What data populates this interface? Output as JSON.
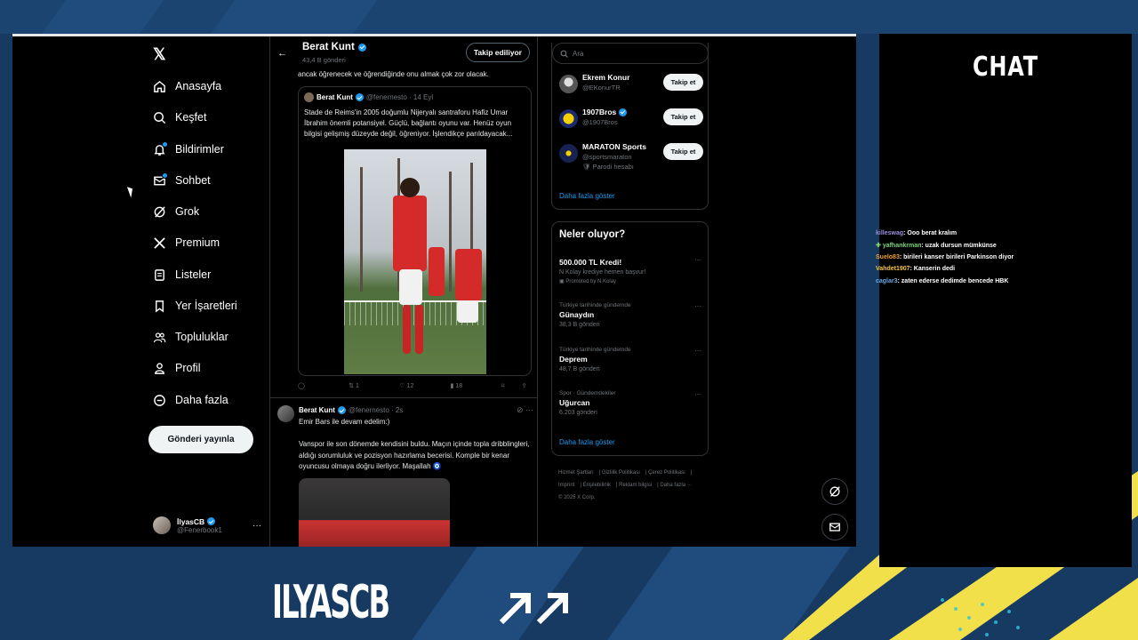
{
  "nav": {
    "items": [
      {
        "label": "Anasayfa",
        "icon": "home-icon"
      },
      {
        "label": "Keşfet",
        "icon": "search-icon"
      },
      {
        "label": "Bildirimler",
        "icon": "bell-icon"
      },
      {
        "label": "Sohbet",
        "icon": "mail-icon"
      },
      {
        "label": "Grok",
        "icon": "grok-icon"
      },
      {
        "label": "Premium",
        "icon": "x-icon"
      },
      {
        "label": "Listeler",
        "icon": "list-icon"
      },
      {
        "label": "Yer İşaretleri",
        "icon": "bookmark-icon"
      },
      {
        "label": "Topluluklar",
        "icon": "people-icon"
      },
      {
        "label": "Profil",
        "icon": "person-icon"
      },
      {
        "label": "Daha fazla",
        "icon": "more-circle-icon"
      }
    ],
    "post_button": "Gönderi yayınla",
    "account": {
      "name": "İlyasCB",
      "handle": "@Fenerbook1"
    }
  },
  "thread": {
    "header": {
      "name": "Berat Kunt",
      "posts": "43,4 B gönderi",
      "follow_label": "Takip ediliyor"
    },
    "snippet": "ancak öğrenecek ve öğrendiğinde onu almak çok zor olacak.",
    "quote": {
      "name": "Berat Kunt",
      "handle": "@fenernesto · 14 Eyl",
      "text": "Stade de Reims'in 2005 doğumlu Nijeryalı santraforu Hafiz Umar İbrahim önemli potansiyel. Güçlü, bağlantı oyunu var. Henüz oyun bilgisi gelişmiş düzeyde değil, öğreniyor. İşlendikçe parıldayacak..."
    },
    "actions": {
      "retweets": "1",
      "likes": "12",
      "views": "18"
    },
    "post2": {
      "name": "Berat Kunt",
      "handle": "@fenernesto · 2s",
      "line1": "Emir Bars ile devam edelim:)",
      "text": "Vanspor ile son dönemde kendisini buldu. Maçın içinde topla dribblingleri, aldığı sorumluluk ve pozisyon hazırlama becerisi. Komple bir kenar oyuncusu olmaya doğru ilerliyor. Maşallah 🧿"
    }
  },
  "search": {
    "placeholder": "Ara"
  },
  "who_to_follow": {
    "items": [
      {
        "name": "Ekrem Konur",
        "handle": "@EKonurTR",
        "extra": "",
        "button": "Takip et"
      },
      {
        "name": "1907Bros",
        "handle": "@1907Bros",
        "extra": "",
        "button": "Takip et"
      },
      {
        "name": "MARATON Sports",
        "handle": "@sportsmaraton",
        "extra": "🛡 Parodi hesabı",
        "button": "Takip et"
      }
    ],
    "more": "Daha fazla göster"
  },
  "trends": {
    "title": "Neler oluyor?",
    "items": [
      {
        "context": "",
        "title": "500.000 TL Kredi!",
        "count": "N Kolay krediye hemen başvur!",
        "promo": "Promoted by N Kolay"
      },
      {
        "context": "Türkiye tarihinde gündemde",
        "title": "Günaydın",
        "count": "38,3 B gönderi",
        "promo": ""
      },
      {
        "context": "Türkiye tarihinde gündemde",
        "title": "Deprem",
        "count": "48,7 B gönderi",
        "promo": ""
      },
      {
        "context": "Spor · Gündemdekiler",
        "title": "Uğurcan",
        "count": "6.203 gönderi",
        "promo": ""
      }
    ],
    "more": "Daha fazla göster"
  },
  "footer": {
    "links": [
      "Hizmet Şartları",
      "Gizlilik Politikası",
      "Çerez Politikası",
      "Imprint",
      "Erişilebilirlik",
      "Reklam bilgisi",
      "Daha fazla ···",
      "© 2025 X Corp."
    ]
  },
  "chat": {
    "title": "CHAT",
    "messages": [
      {
        "user": "killeswag",
        "text": ": Ooo berat kralım",
        "color": "#9b8fd8"
      },
      {
        "user": "yafhankrman",
        "text": ": uzak dursun mümkünse",
        "color": "#7fd37f"
      },
      {
        "user": "Suelo83",
        "text": ": birileri kanser birileri Parkinson diyor",
        "color": "#f0a030"
      },
      {
        "user": "Vahdet1907",
        "text": ": Kanserin dedi",
        "color": "#f5c542"
      },
      {
        "user": "caglar3",
        "text": ": zaten ederse dedimde bencede HBK",
        "color": "#6aa7e0"
      }
    ]
  },
  "overlay": {
    "brand": "ILYASCB"
  },
  "colors": {
    "accent": "#1d9bf0",
    "bg": "#000000",
    "overlay_blue": "#173a63",
    "yellow": "#f2e04b"
  }
}
